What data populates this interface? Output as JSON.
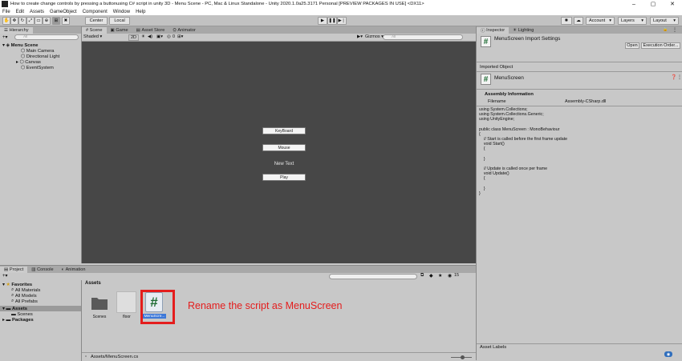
{
  "window": {
    "title": "How to create change controls by pressing a buttonusing C# script in unity 3D - Menu Scene - PC, Mac & Linux Standalone - Unity 2020.1.0a25.3171 Personal [PREVIEW PACKAGES IN USE] <DX11>",
    "minimize": "–",
    "maximize": "▢",
    "close": "✕"
  },
  "menubar": [
    "File",
    "Edit",
    "Assets",
    "GameObject",
    "Component",
    "Window",
    "Help"
  ],
  "toolbar": {
    "center": "Center",
    "local": "Local",
    "account": "Account",
    "layers": "Layers",
    "layout": "Layout"
  },
  "hierarchy": {
    "tab": "Hierarchy",
    "search_placeholder": "All",
    "scene": "Menu Scene",
    "items": [
      "Main Camera",
      "Directional Light",
      "Canvas",
      "EventSystem"
    ]
  },
  "scene": {
    "tabs": [
      "Scene",
      "Game",
      "Asset Store",
      "Animator"
    ],
    "shading": "Shaded",
    "mode2d": "2D",
    "gizmos": "Gizmos",
    "search_placeholder": "All",
    "zero": "0",
    "buttons": [
      "KeyBoard",
      "Mouse"
    ],
    "new_text": "New Text",
    "play": "Play"
  },
  "inspector": {
    "tabs": [
      "Inspector",
      "Lighting"
    ],
    "header_title": "MenuScreen Import Settings",
    "open": "Open",
    "execution_order": "Execution Order...",
    "imported_object": "Imported Object",
    "object_name": "MenuScreen",
    "assembly_info": "Assembly Information",
    "filename_label": "Filename",
    "filename_value": "Assembly-CSharp.dll",
    "code": "using System.Collections;\nusing System.Collections.Generic;\nusing UnityEngine;\n\npublic class MenuScreen : MonoBehaviour\n{\n    // Start is called before the first frame update\n    void Start()\n    {\n\n    }\n\n    // Update is called once per frame\n    void Update()\n    {\n\n    }\n}",
    "asset_labels": "Asset Labels"
  },
  "project": {
    "tabs": [
      "Project",
      "Console",
      "Animation"
    ],
    "favorites": "Favorites",
    "fav_items": [
      "All Materials",
      "All Models",
      "All Prefabs"
    ],
    "assets": "Assets",
    "asset_children": [
      "Scenes"
    ],
    "packages": "Packages",
    "breadcrumb": "Assets",
    "items": [
      "Scenes",
      "floor",
      "MenuScre..."
    ],
    "annotation": "Rename the script as MenuScreen",
    "status_path": "Assets/MenuScreen.cs",
    "count": "15"
  },
  "colors": {
    "annotation_red": "#e41d1d",
    "selection_blue": "#3d78d8",
    "scene_bg": "#474747"
  }
}
